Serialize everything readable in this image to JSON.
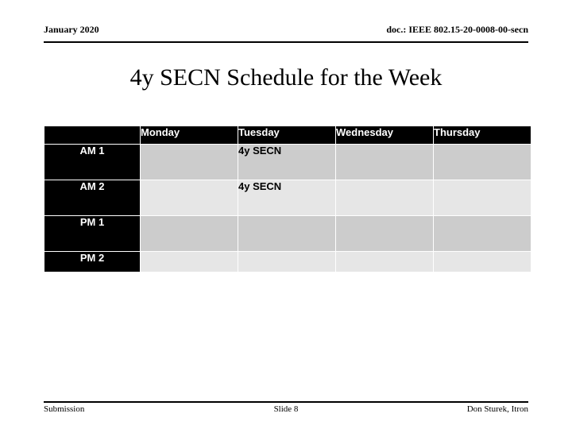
{
  "header": {
    "date": "January 2020",
    "doc_ref": "doc.: IEEE 802.15-20-0008-00-secn"
  },
  "title": "4y SECN Schedule for the Week",
  "schedule": {
    "corner_label": "",
    "columns": [
      "Monday",
      "Tuesday",
      "Wednesday",
      "Thursday"
    ],
    "rows": [
      {
        "label": "AM 1",
        "cells": [
          "",
          "4y SECN",
          "",
          ""
        ]
      },
      {
        "label": "AM 2",
        "cells": [
          "",
          "4y SECN",
          "",
          ""
        ]
      },
      {
        "label": "PM 1",
        "cells": [
          "",
          "",
          "",
          ""
        ]
      },
      {
        "label": "PM 2",
        "cells": [
          "",
          "",
          "",
          ""
        ]
      }
    ]
  },
  "footer": {
    "left": "Submission",
    "center": "Slide 8",
    "right": "Don Sturek, Itron"
  },
  "colors": {
    "header_fill": "#000000",
    "header_text": "#ffffff",
    "row_dark": "#cccccc",
    "row_light": "#e6e6e6",
    "text": "#000000",
    "page": "#ffffff"
  }
}
